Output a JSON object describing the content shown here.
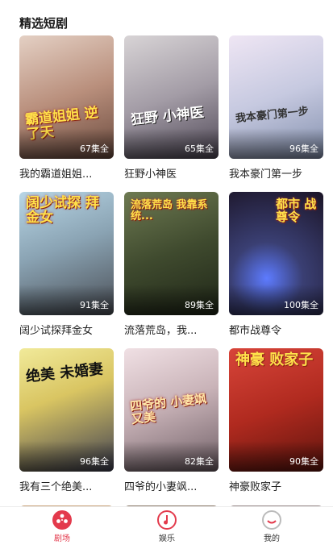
{
  "section": {
    "title": "精选短剧"
  },
  "dramas": [
    {
      "title": "我的霸道姐姐...",
      "episodes": "67集全",
      "tagline": "霸道姐姐 逆了天",
      "colors": [
        "#d9c2b5",
        "#8c6a5b"
      ]
    },
    {
      "title": "狂野小神医",
      "episodes": "65集全",
      "tagline": "狂野 小神医",
      "colors": [
        "#c4c0c3",
        "#6a6370"
      ]
    },
    {
      "title": "我本豪门第一步",
      "episodes": "96集全",
      "tagline": "我本豪门第一步",
      "colors": [
        "#d9cfe8",
        "#9aa7c2"
      ]
    },
    {
      "title": "阔少试探拜金女",
      "episodes": "91集全",
      "tagline": "阔少试探 拜金女",
      "colors": [
        "#a7c6d8",
        "#5d6d79"
      ]
    },
    {
      "title": "流落荒岛，我...",
      "episodes": "89集全",
      "tagline": "流落荒岛 我靠系统...",
      "colors": [
        "#5e6a45",
        "#2b3322"
      ]
    },
    {
      "title": "都市战尊令",
      "episodes": "100集全",
      "tagline": "都市 战尊令",
      "colors": [
        "#3a3f73",
        "#1b1426"
      ]
    },
    {
      "title": "我有三个绝美...",
      "episodes": "96集全",
      "tagline": "绝美 未婚妻",
      "colors": [
        "#e9e1a0",
        "#4c4c5e"
      ]
    },
    {
      "title": "四爷的小妻飒...",
      "episodes": "82集全",
      "tagline": "四爷的 小妻飒又美",
      "colors": [
        "#e7d3d8",
        "#8d7a80"
      ]
    },
    {
      "title": "神豪败家子",
      "episodes": "90集全",
      "tagline": "神豪 败家子",
      "colors": [
        "#c8382a",
        "#7a1a12"
      ]
    }
  ],
  "tabbar": {
    "items": [
      {
        "label": "剧场",
        "icon": "film-reel-icon",
        "active": true
      },
      {
        "label": "娱乐",
        "icon": "music-note-icon",
        "active": false
      },
      {
        "label": "我的",
        "icon": "profile-smile-icon",
        "active": false
      }
    ],
    "accent": "#e33a4c"
  }
}
